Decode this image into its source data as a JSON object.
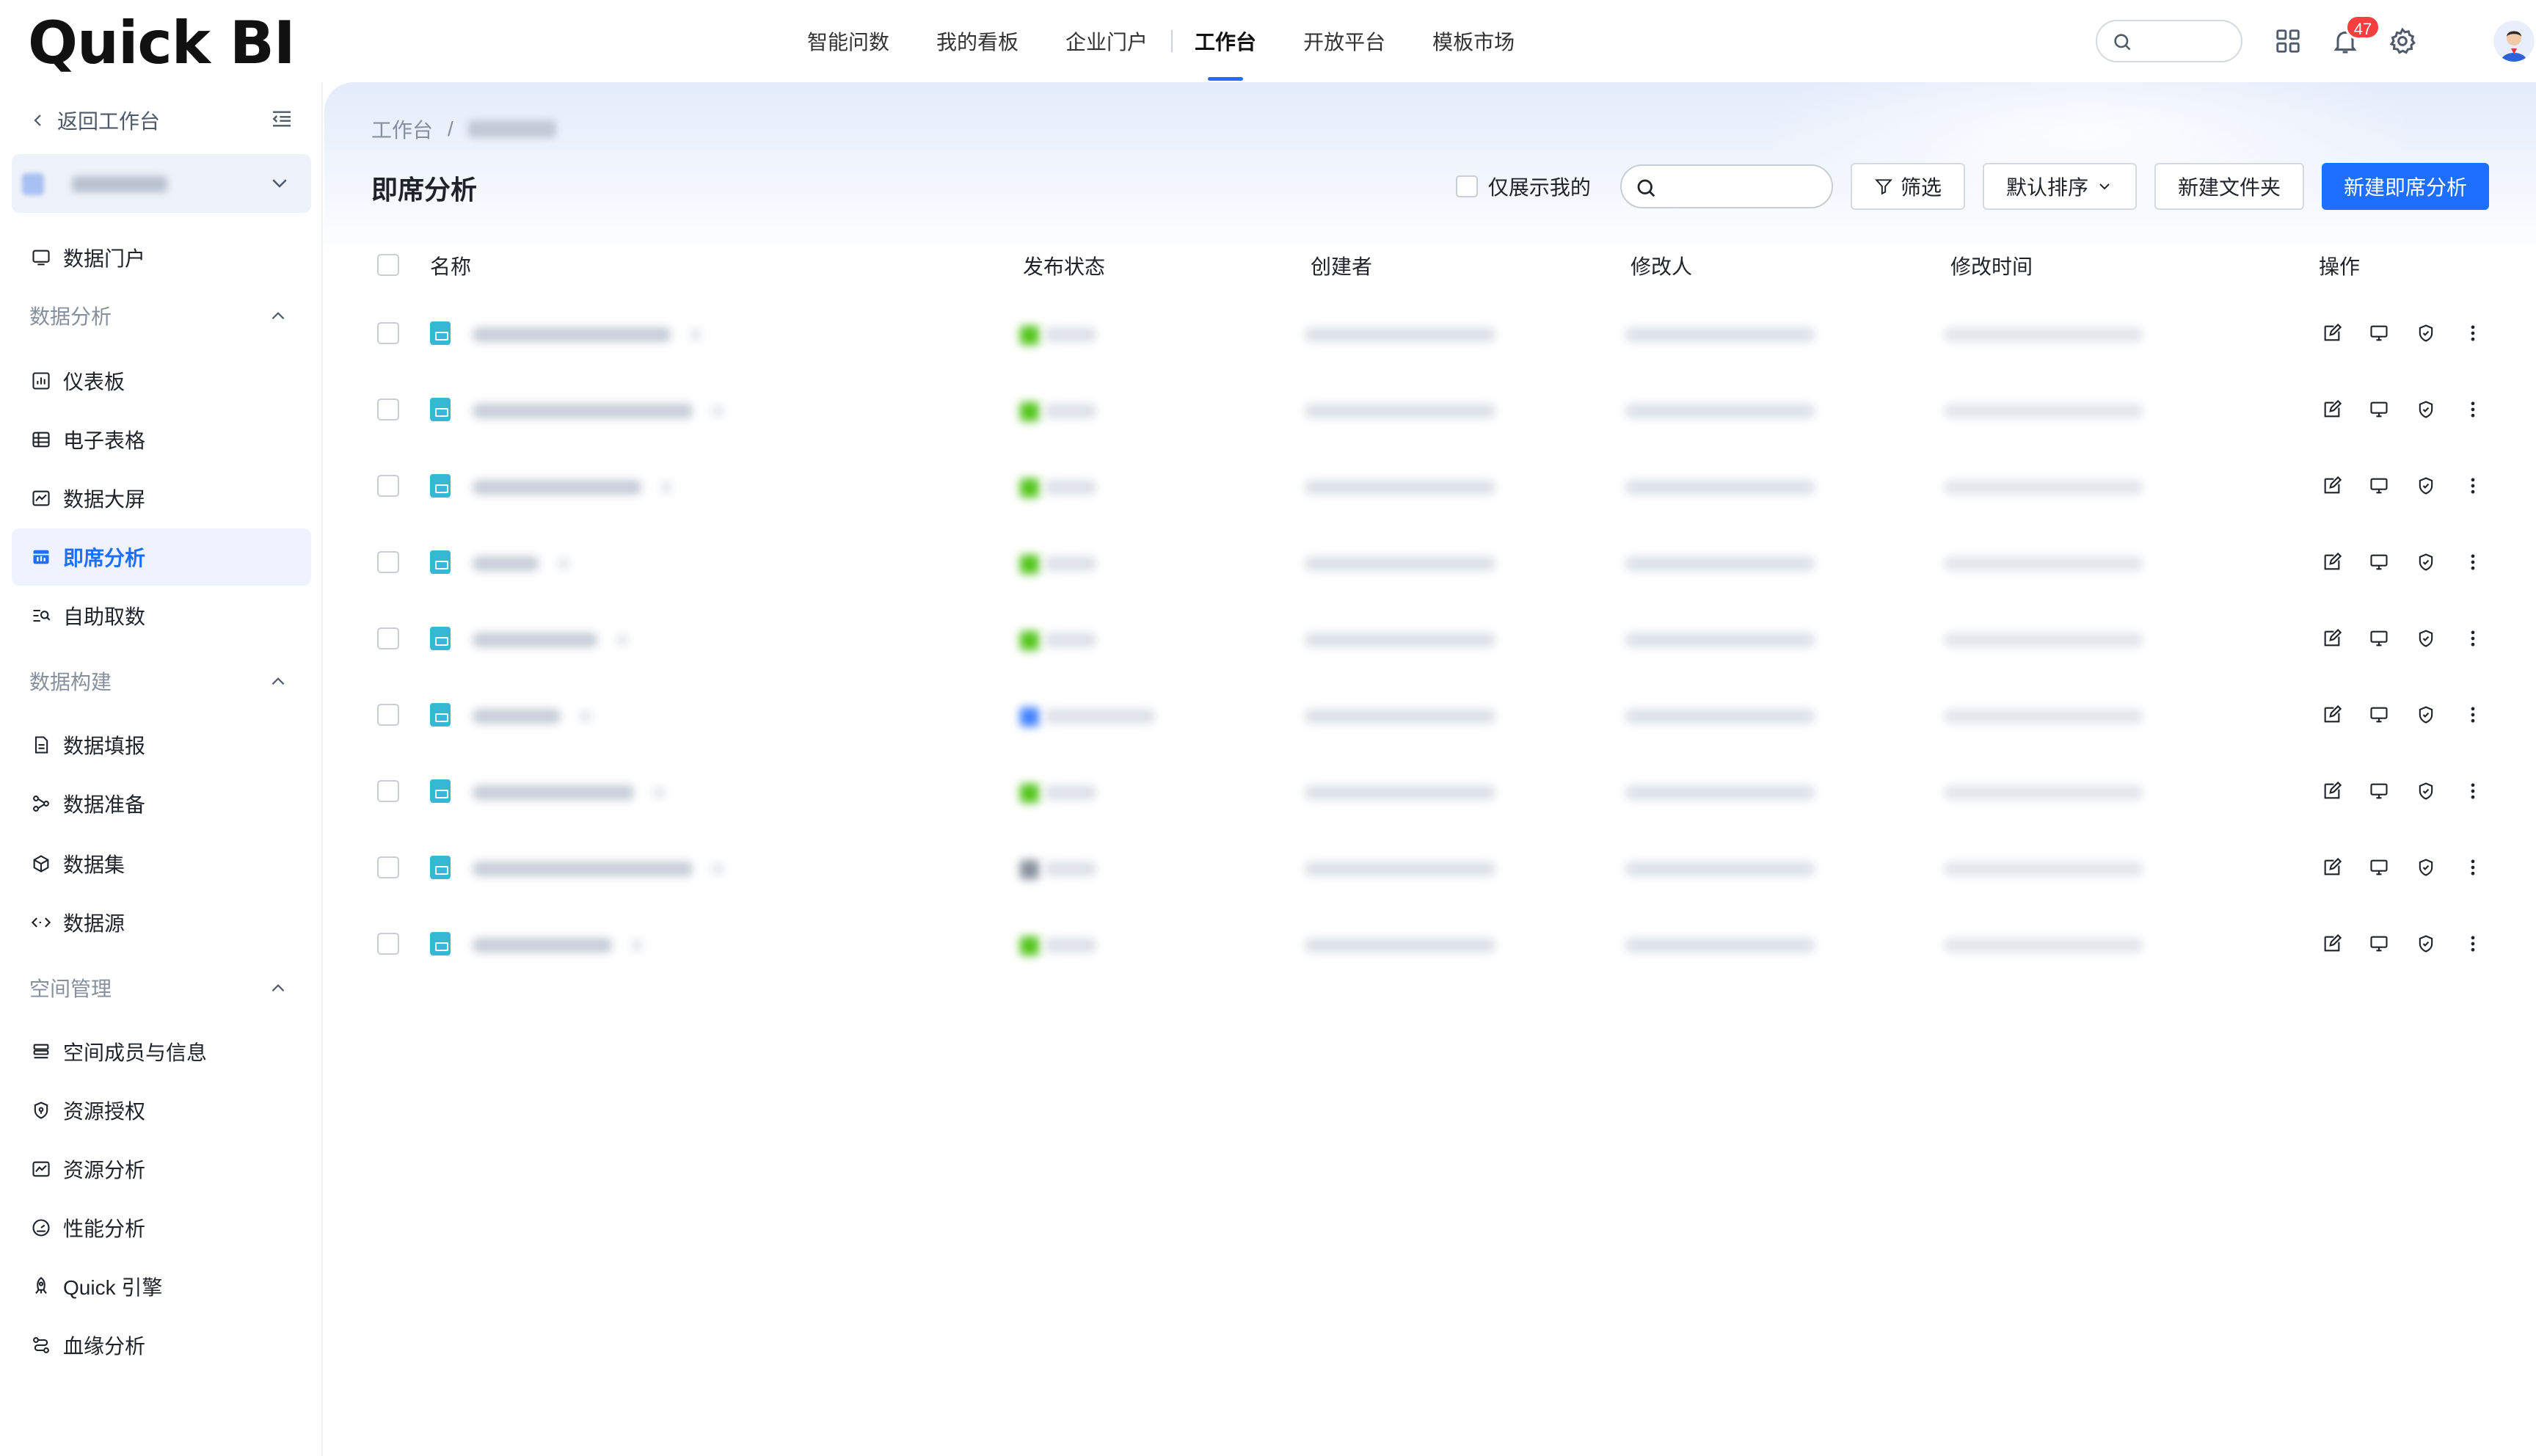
{
  "app": {
    "logo": "Quick BI"
  },
  "top_nav": {
    "items": [
      {
        "label": "智能问数",
        "active": false
      },
      {
        "label": "我的看板",
        "active": false
      },
      {
        "label": "企业门户",
        "active": false
      },
      {
        "label": "工作台",
        "active": true
      },
      {
        "label": "开放平台",
        "active": false
      },
      {
        "label": "模板市场",
        "active": false
      }
    ],
    "notification_count": "47",
    "icons": [
      "search-icon",
      "grid-apps-icon",
      "bell-icon",
      "gear-icon",
      "avatar"
    ]
  },
  "sidebar": {
    "back_label": "返回工作台",
    "groups": {
      "data_analysis": "数据分析",
      "data_build": "数据构建",
      "space_manage": "空间管理"
    },
    "items": {
      "portal": "数据门户",
      "dashboard": "仪表板",
      "spreadsheet": "电子表格",
      "screen": "数据大屏",
      "adhoc": "即席分析",
      "self_fetch": "自助取数",
      "fill": "数据填报",
      "prep": "数据准备",
      "dataset": "数据集",
      "datasource": "数据源",
      "members": "空间成员与信息",
      "auth": "资源授权",
      "res_analysis": "资源分析",
      "perf": "性能分析",
      "engine": "Quick 引擎",
      "lineage": "血缘分析"
    },
    "active_item": "adhoc"
  },
  "main": {
    "breadcrumb_root": "工作台",
    "breadcrumb_sep": "/",
    "title": "即席分析",
    "toolbar": {
      "only_mine": "仅展示我的",
      "filter": "筛选",
      "sort": "默认排序",
      "new_folder": "新建文件夹",
      "new_adhoc": "新建即席分析"
    },
    "table": {
      "headers": {
        "name": "名称",
        "status": "发布状态",
        "creator": "创建者",
        "modifier": "修改人",
        "modified_time": "修改时间",
        "actions": "操作"
      },
      "row_count": 9,
      "status_colors": [
        "#52c41a",
        "#52c41a",
        "#52c41a",
        "#52c41a",
        "#52c41a",
        "#4080ff",
        "#52c41a",
        "#86909c",
        "#52c41a"
      ]
    }
  },
  "colors": {
    "accent": "#1e6fff",
    "active_bg": "#eef3ff"
  }
}
